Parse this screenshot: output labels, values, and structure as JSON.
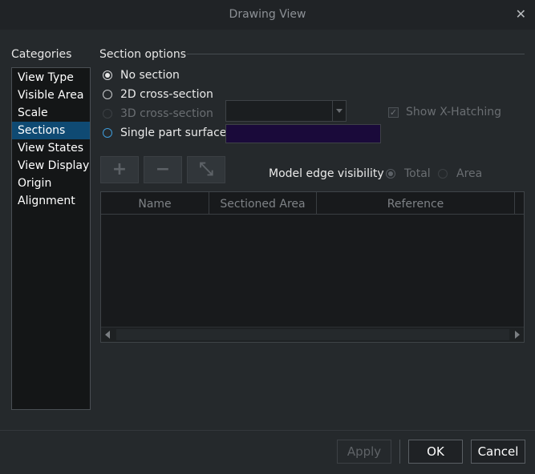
{
  "window": {
    "title": "Drawing View"
  },
  "categories": {
    "label": "Categories",
    "items": [
      "View Type",
      "Visible Area",
      "Scale",
      "Sections",
      "View States",
      "View Display",
      "Origin",
      "Alignment"
    ],
    "selected": "Sections"
  },
  "section_options": {
    "label": "Section options",
    "options": {
      "no_section": "No section",
      "cross_2d": "2D cross-section",
      "cross_3d": "3D cross-section",
      "single_part_surface": "Single part surface"
    },
    "selected": "No section",
    "show_x_hatching": {
      "label": "Show X-Hatching",
      "checked": true,
      "enabled": false
    },
    "surface_color": "#1a0a3a"
  },
  "toolbar": {
    "add_glyph": "+",
    "remove_glyph": "−",
    "flip_glyph": "⤡"
  },
  "model_edge_visibility": {
    "label": "Model edge visibility",
    "options": {
      "total": "Total",
      "area": "Area"
    },
    "selected": "Total"
  },
  "table": {
    "columns": [
      "Name",
      "Sectioned Area",
      "Reference"
    ],
    "rows": []
  },
  "buttons": {
    "apply": "Apply",
    "ok": "OK",
    "cancel": "Cancel"
  },
  "colors": {
    "accent": "#0f4a73",
    "radio_focus": "#3e9bd9"
  }
}
